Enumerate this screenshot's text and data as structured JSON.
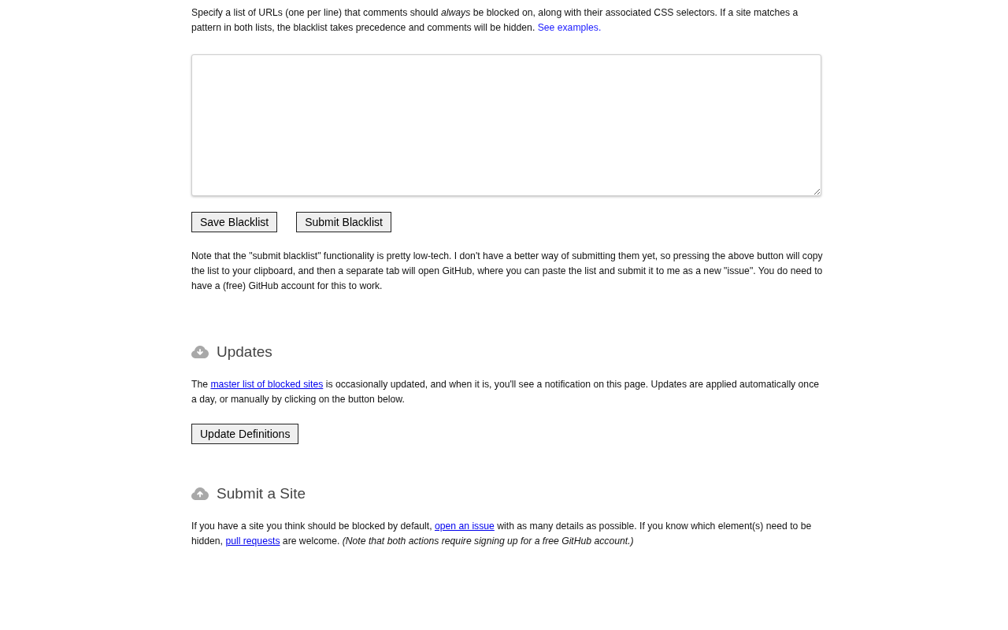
{
  "blacklist_section": {
    "intro": [
      {
        "kind": "text",
        "text": "Specify a list of URLs (one per line) that comments should *always* be blocked on, along with their associated CSS selectors. If a site matches a pattern in both lists, the blacklist takes precedence and comments will be hidden. "
      },
      {
        "kind": "link",
        "text": "See examples.",
        "underlined": false
      }
    ],
    "list_field": {
      "resizable": true
    },
    "buttons": [
      {
        "label": "Save Blacklist"
      },
      {
        "label": "Submit Blacklist"
      }
    ],
    "note": [
      {
        "kind": "text",
        "text": "Note that the \"submit blacklist\" functionality is pretty low-tech. I don't have a better way of submitting them yet, so pressing the above button will copy the list to your clipboard, and then a separate tab will open GitHub, where you can paste the list and submit it to me as a new \"issue\". You do need to have a (free) GitHub account for this to work."
      }
    ]
  },
  "sections": [
    {
      "kind": "download",
      "title": "Updates",
      "body": [
        {
          "kind": "text",
          "text": "The "
        },
        {
          "kind": "link",
          "text": "master list of blocked sites",
          "underlined": true
        },
        {
          "kind": "text",
          "text": " is occasionally updated, and when it is, you'll see a notification on this page. Updates are applied automatically once a day, or manually by clicking on the button below."
        }
      ],
      "buttons": [
        {
          "label": "Update Definitions"
        }
      ]
    },
    {
      "kind": "upload",
      "title": "Submit a Site",
      "body": [
        {
          "kind": "text",
          "text": "If you have a site you think should be blocked by default, "
        },
        {
          "kind": "link",
          "text": "open an issue",
          "underlined": true
        },
        {
          "kind": "text",
          "text": " with as many details as possible. If you know which element(s) need to be hidden, "
        },
        {
          "kind": "link",
          "text": "pull requests",
          "underlined": true
        },
        {
          "kind": "text",
          "text": " are welcome. *(Note that both actions require signing up for a free GitHub account.)*"
        }
      ]
    }
  ]
}
